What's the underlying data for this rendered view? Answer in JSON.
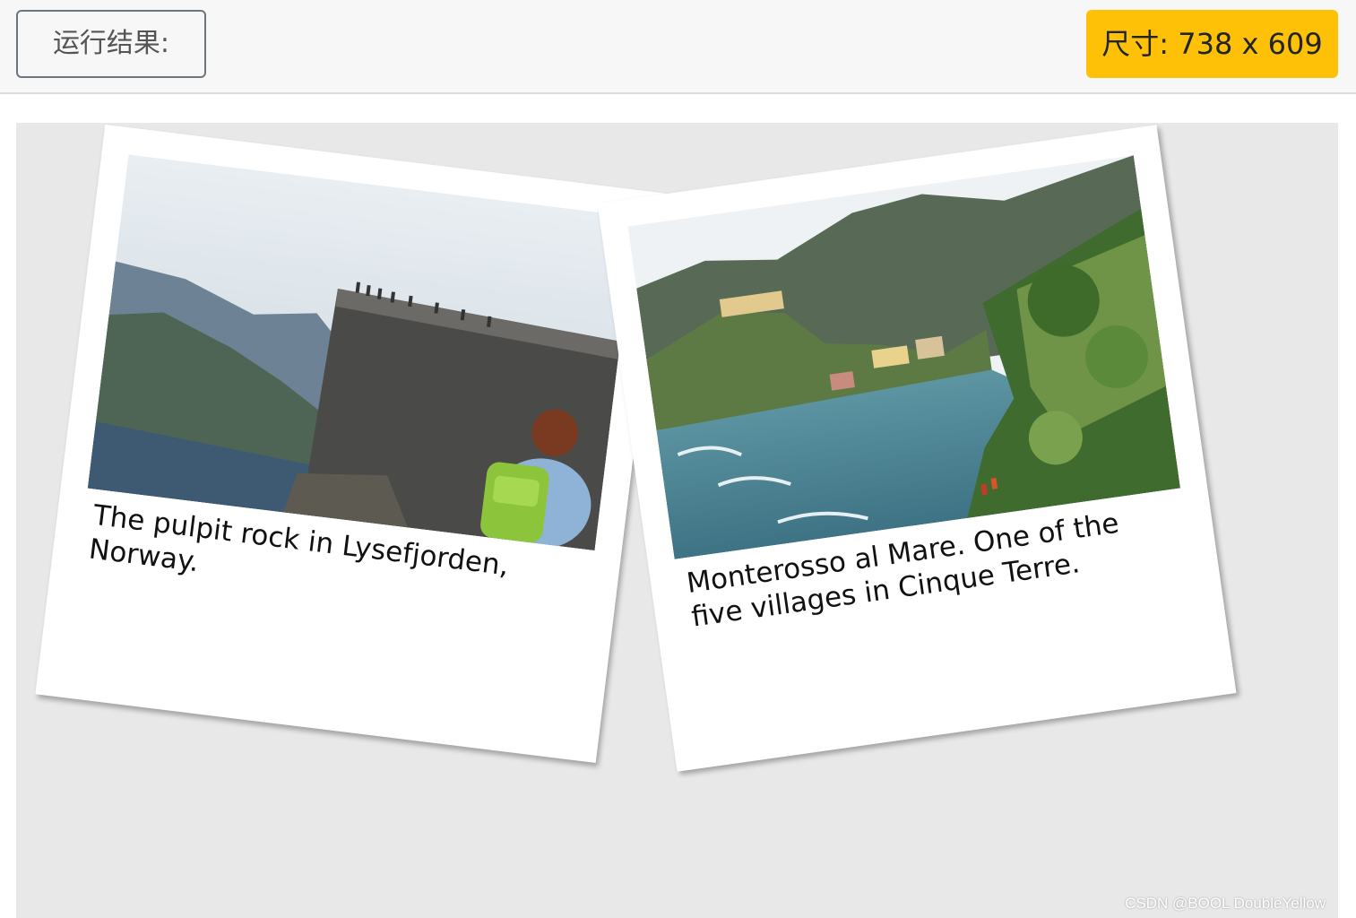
{
  "toolbar": {
    "result_label": "运行结果:",
    "size_label": "尺寸: 738 x 609"
  },
  "cards": [
    {
      "caption": "The pulpit rock in Lysefjorden, Norway."
    },
    {
      "caption": "Monterosso al Mare. One of the five villages in Cinque Terre."
    }
  ],
  "watermark": "CSDN @BOOL DoubleYellow",
  "colors": {
    "accent": "#ffc107",
    "stage_bg": "#e8e8e8",
    "topbar_bg": "#f7f7f7"
  }
}
